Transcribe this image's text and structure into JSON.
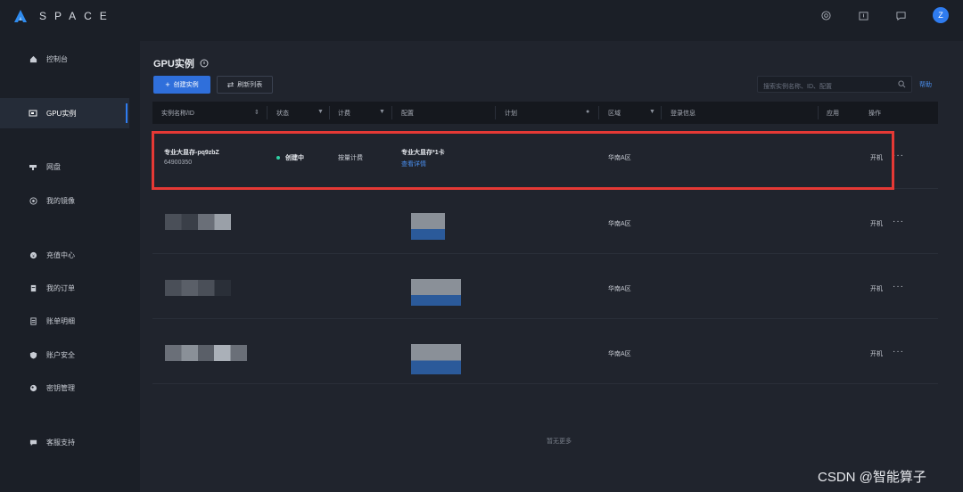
{
  "app": {
    "logo_text": "SPACE",
    "avatar_initial": "Z"
  },
  "top_icons": [
    "help-circle-icon",
    "gift-icon",
    "message-icon"
  ],
  "sidebar": {
    "items": [
      {
        "label": "控制台",
        "icon": "home-icon",
        "active": false
      },
      {
        "label": "GPU实例",
        "icon": "gpu-icon",
        "active": true
      },
      {
        "label": "网盘",
        "icon": "disk-icon",
        "active": false
      },
      {
        "label": "我的镜像",
        "icon": "image-icon",
        "active": false
      },
      {
        "label": "充值中心",
        "icon": "wallet-icon",
        "active": false
      },
      {
        "label": "我的订单",
        "icon": "order-icon",
        "active": false
      },
      {
        "label": "账单明细",
        "icon": "bill-icon",
        "active": false
      },
      {
        "label": "账户安全",
        "icon": "shield-icon",
        "active": false
      },
      {
        "label": "密钥管理",
        "icon": "key-icon",
        "active": false
      },
      {
        "label": "客服支持",
        "icon": "chat-icon",
        "active": false
      }
    ]
  },
  "main": {
    "title": "GPU实例",
    "create_button": "创建实例",
    "refresh_button": "刷新列表",
    "search_placeholder": "搜索实例名称、ID、配置",
    "help_link": "帮助",
    "columns": [
      "实例名称/ID",
      "状态",
      "计费",
      "配置",
      "计划",
      "区域",
      "登录信息",
      "应用",
      "操作"
    ],
    "rows": [
      {
        "name": "专业大显存-pq9zbZ",
        "id": "64900350",
        "status": "创建中",
        "billing": "按量计费",
        "config": "专业大显存*1卡",
        "config_link": "查看详情",
        "region": "华南A区",
        "action": "开机"
      },
      {
        "region": "华南A区",
        "action": "开机"
      },
      {
        "region": "华南A区",
        "action": "开机"
      },
      {
        "region": "华南A区",
        "action": "开机"
      }
    ],
    "empty_text": "暂无更多"
  },
  "watermark": "CSDN @智能算子",
  "colors": {
    "accent": "#2f6fdb",
    "status_creating": "#2ed1a4",
    "highlight": "#e53935"
  }
}
